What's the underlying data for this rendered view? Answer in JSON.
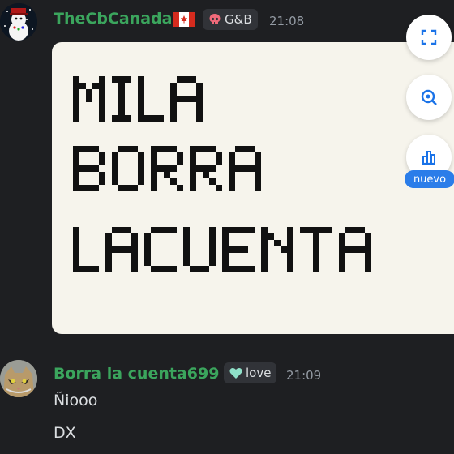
{
  "messages": [
    {
      "username": "TheCbCanada",
      "flag": "canada-flag",
      "badge": {
        "icon": "skull-icon",
        "label": "G&B"
      },
      "time": "21:08",
      "image_text": [
        "MILA",
        "BORRA",
        "LACUENTA"
      ],
      "overlay_buttons": [
        {
          "icon": "qr-scan-icon"
        },
        {
          "icon": "visual-search-icon"
        },
        {
          "icon": "bar-chart-icon",
          "badge": "nuevo"
        }
      ]
    },
    {
      "username": "Borra la cuenta699",
      "badge": {
        "icon": "heart-icon",
        "label": "love"
      },
      "time": "21:09",
      "lines": [
        "Ñiooo",
        "DX"
      ]
    }
  ],
  "colors": {
    "background": "#1e1f22",
    "username": "#3ba55d",
    "card": "#f6f4ec",
    "accent": "#2b7de9"
  }
}
